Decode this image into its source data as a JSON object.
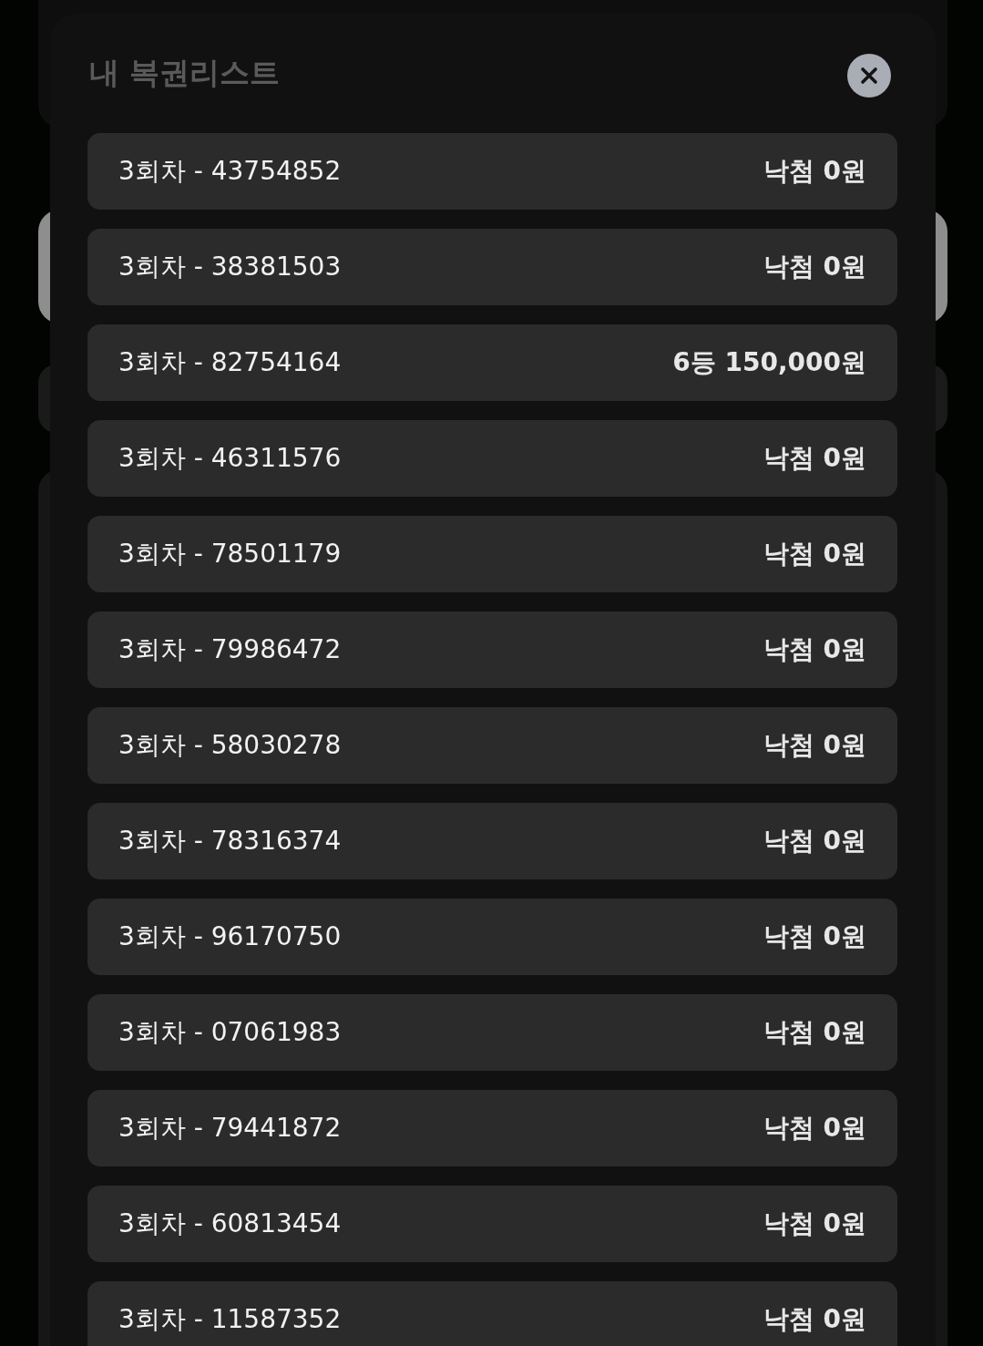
{
  "modal": {
    "title": "내 복권리스트"
  },
  "tickets": [
    {
      "label": "3회차 - 43754852",
      "result": "낙첨 0원"
    },
    {
      "label": "3회차 - 38381503",
      "result": "낙첨 0원"
    },
    {
      "label": "3회차 - 82754164",
      "result": "6등 150,000원"
    },
    {
      "label": "3회차 - 46311576",
      "result": "낙첨 0원"
    },
    {
      "label": "3회차 - 78501179",
      "result": "낙첨 0원"
    },
    {
      "label": "3회차 - 79986472",
      "result": "낙첨 0원"
    },
    {
      "label": "3회차 - 58030278",
      "result": "낙첨 0원"
    },
    {
      "label": "3회차 - 78316374",
      "result": "낙첨 0원"
    },
    {
      "label": "3회차 - 96170750",
      "result": "낙첨 0원"
    },
    {
      "label": "3회차 - 07061983",
      "result": "낙첨 0원"
    },
    {
      "label": "3회차 - 79441872",
      "result": "낙첨 0원"
    },
    {
      "label": "3회차 - 60813454",
      "result": "낙첨 0원"
    },
    {
      "label": "3회차 - 11587352",
      "result": "낙첨 0원"
    }
  ]
}
